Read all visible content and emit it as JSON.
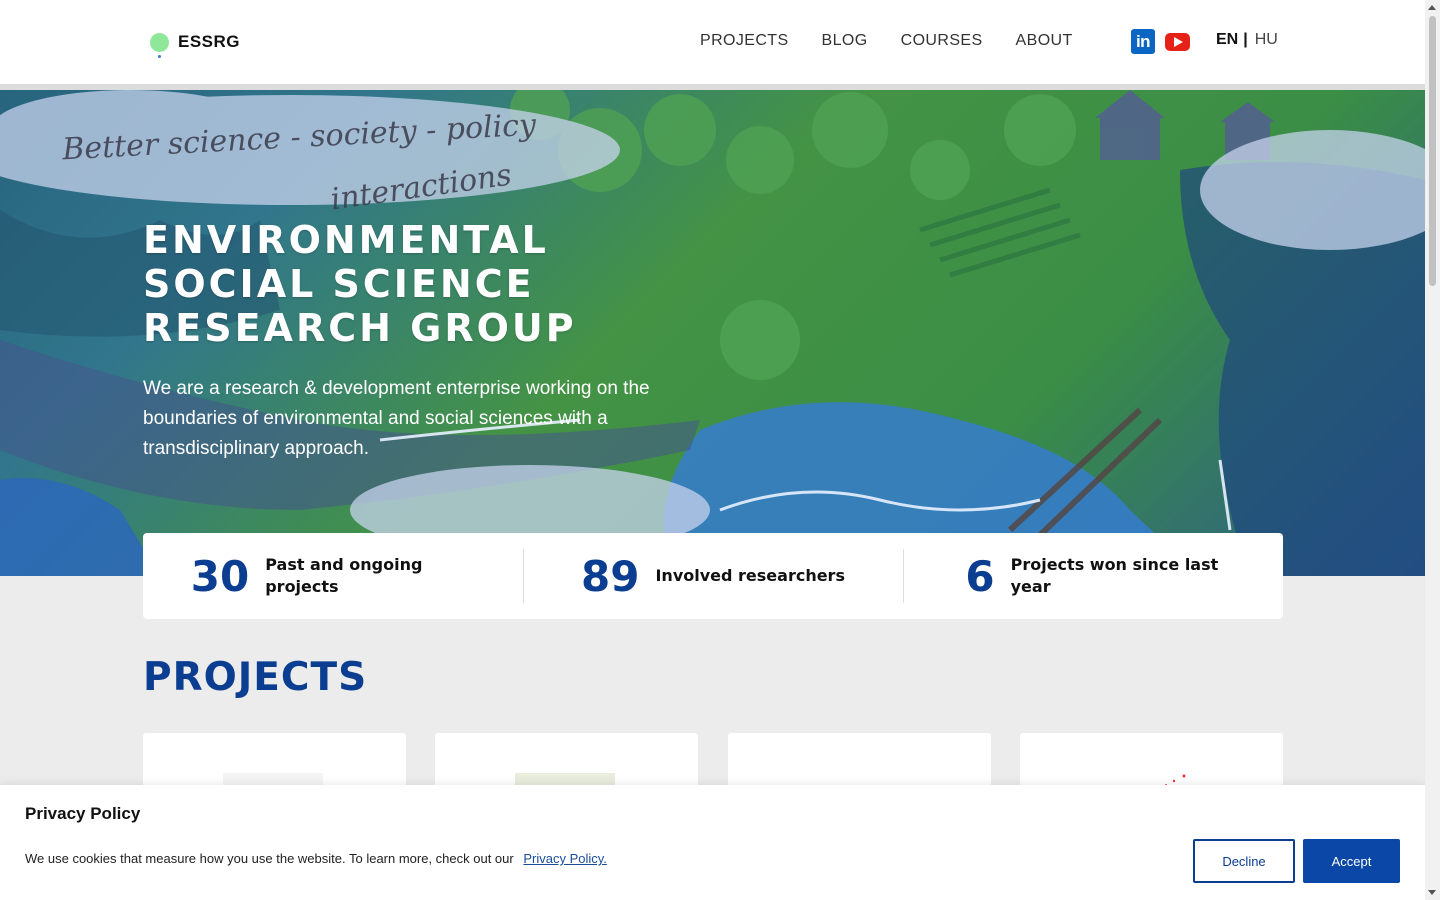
{
  "header": {
    "logo_text": "ESSRG",
    "nav": [
      "PROJECTS",
      "BLOG",
      "COURSES",
      "ABOUT"
    ],
    "social": {
      "linkedin_icon": "linkedin-icon",
      "youtube_icon": "youtube-icon",
      "linkedin_label": "in"
    },
    "lang": {
      "active": "EN",
      "separator": "|",
      "other": "HU"
    }
  },
  "hero": {
    "title_lines": [
      "ENVIRONMENTAL",
      "SOCIAL SCIENCE",
      "RESEARCH GROUP"
    ],
    "description": "We are a research & development enterprise working on the boundaries of environmental and social sciences with a transdisciplinary approach.",
    "handwriting_1": "Better science - society - policy",
    "handwriting_2": "interactions"
  },
  "stats": [
    {
      "value": "30",
      "label": "Past and ongoing projects"
    },
    {
      "value": "89",
      "label": "Involved researchers"
    },
    {
      "value": "6",
      "label": "Projects won since last year"
    }
  ],
  "projects": {
    "title": "PROJECTS"
  },
  "privacy": {
    "title": "Privacy Policy",
    "text": "We use cookies that measure how you use the website. To learn more, check out our",
    "link": "Privacy Policy.",
    "decline": "Decline",
    "accept": "Accept"
  },
  "colors": {
    "brand_blue": "#0b3d91",
    "accept_blue": "#0b47a6",
    "linkedin": "#0a66c2",
    "youtube": "#e62117",
    "logo_green": "#8fe89a"
  }
}
